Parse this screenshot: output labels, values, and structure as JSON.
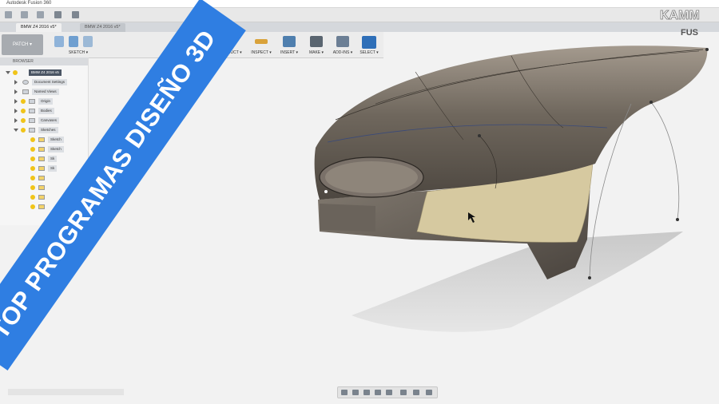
{
  "app": {
    "window_title": "Autodesk Fusion 360",
    "tabs": [
      {
        "label": "BMW Z4 2016 v5*",
        "active": true
      },
      {
        "label": "BMW Z4 2016 v5*",
        "active": false
      }
    ]
  },
  "ribbon": {
    "workspace": "PATCH ▾",
    "groups": [
      {
        "label": "SKETCH ▾",
        "icon": "sketch-icon"
      },
      {
        "label": "CONSTRUCT ▾",
        "icon": "construct-icon"
      },
      {
        "label": "INSPECT ▾",
        "icon": "inspect-icon"
      },
      {
        "label": "INSERT ▾",
        "icon": "insert-icon"
      },
      {
        "label": "MAKE ▾",
        "icon": "make-icon"
      },
      {
        "label": "ADD-INS ▾",
        "icon": "add-ins-icon"
      },
      {
        "label": "SELECT ▾",
        "icon": "select-icon"
      }
    ]
  },
  "browser": {
    "header": "BROWSER",
    "root": "BMW Z4 2016 v5",
    "items": [
      {
        "label": "Document Settings"
      },
      {
        "label": "Named Views"
      },
      {
        "label": "Origin"
      },
      {
        "label": "Bodies"
      },
      {
        "label": "Canvases"
      },
      {
        "label": "Sketches"
      },
      {
        "label": "Sketch"
      },
      {
        "label": "Sketch"
      },
      {
        "label": "Sk"
      },
      {
        "label": "Sk"
      }
    ]
  },
  "brand": {
    "line1": "KAMM",
    "line2": "FUS"
  },
  "banner": {
    "text": "TOP PROGRAMAS DISEÑO 3D"
  },
  "colors": {
    "banner": "#2f7ee2",
    "surface_dark": "#6e6860",
    "surface_tan": "#d6c9a0"
  }
}
